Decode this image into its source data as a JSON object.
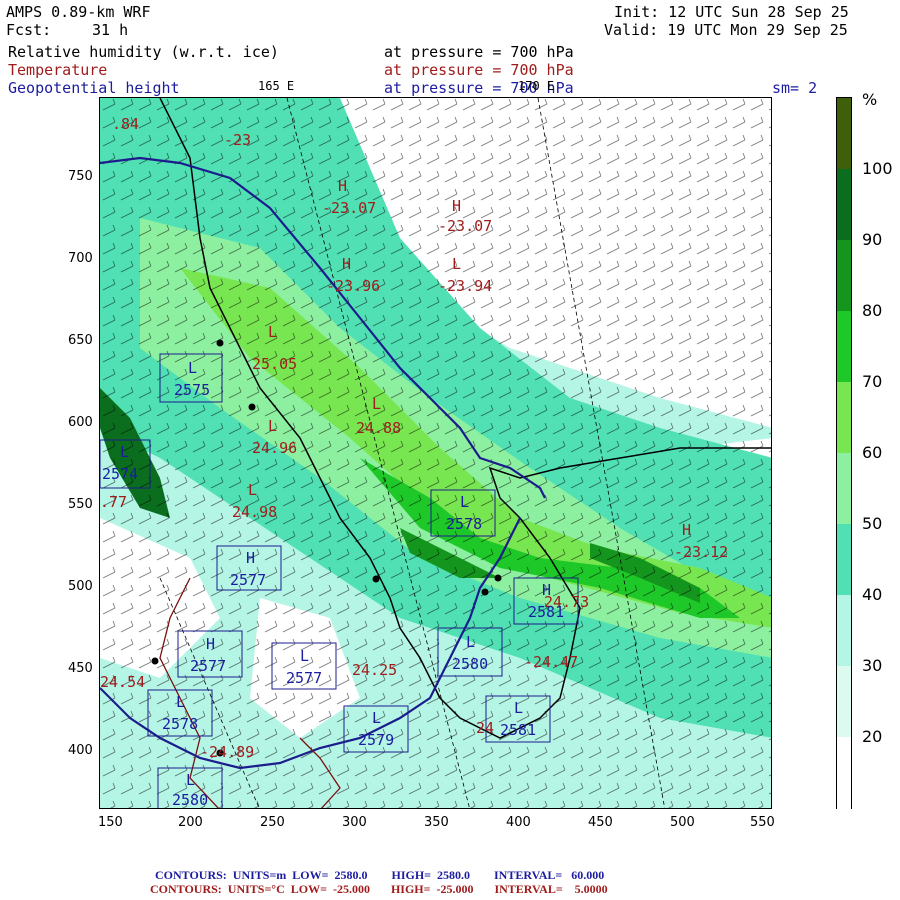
{
  "header": {
    "model": "AMPS 0.89-km WRF",
    "init": "Init: 12 UTC Sun 28 Sep 25",
    "fcst_label": "Fcst:",
    "fcst_value": "31 h",
    "valid": "Valid: 19 UTC Mon 29 Sep 25",
    "fields": [
      {
        "name": "Relative humidity (w.r.t. ice)",
        "pressure": "at pressure =  700 hPa",
        "color": "#000000"
      },
      {
        "name": "Temperature",
        "pressure": "at pressure =  700 hPa",
        "color": "#a01c1c"
      },
      {
        "name": "Geopotential height",
        "pressure": "at pressure =  700 hPa",
        "color": "#1c1ca0"
      }
    ],
    "lon_label_1": "165 E",
    "lon_label_2": "170 E",
    "smoothing": "sm= 2"
  },
  "map": {
    "x_ticks": [
      "150",
      "200",
      "250",
      "300",
      "350",
      "400",
      "450",
      "500",
      "550"
    ],
    "y_ticks": [
      "750",
      "700",
      "650",
      "600",
      "550",
      "500",
      "450",
      "400"
    ],
    "temp_labels": [
      "H",
      "-23.07",
      "H",
      "-23.07",
      "H",
      "-23.96",
      "L",
      "-23.94",
      "L",
      "25.05",
      "L",
      "24.88",
      "L",
      "24.96",
      "L",
      "24.98",
      "H",
      "-23.12",
      "24.73",
      "-24.47",
      "24.25",
      "24.54",
      "24",
      "-24.89",
      ".77",
      "-23",
      ".84"
    ],
    "height_labels": [
      "L",
      "2575",
      "L",
      "2574",
      "H",
      "2577",
      "L",
      "2578",
      "H",
      "2581",
      "L",
      "2577",
      "H",
      "2577",
      "L",
      "2580",
      "L",
      "2578",
      "L",
      "2579",
      "L",
      "2581",
      "L",
      "2580"
    ]
  },
  "colorbar": {
    "unit": "%",
    "labels": [
      "100",
      "90",
      "80",
      "70",
      "60",
      "50",
      "40",
      "30",
      "20"
    ],
    "colors": [
      "#3f5f0a",
      "#0a6e1e",
      "#14961e",
      "#1ec828",
      "#78e650",
      "#8cf0a0",
      "#50e0b4",
      "#b4f5e6",
      "#dcfaf0",
      "#ffffff"
    ]
  },
  "footer": {
    "line1": "CONTOURS:  UNITS=m  LOW=  2580.0        HIGH=  2580.0        INTERVAL=   60.000",
    "line2": "CONTOURS:  UNITS=°C  LOW=  -25.000       HIGH=  -25.000       INTERVAL=    5.0000",
    "color1": "#1c1ca0",
    "color2": "#a01c1c"
  }
}
